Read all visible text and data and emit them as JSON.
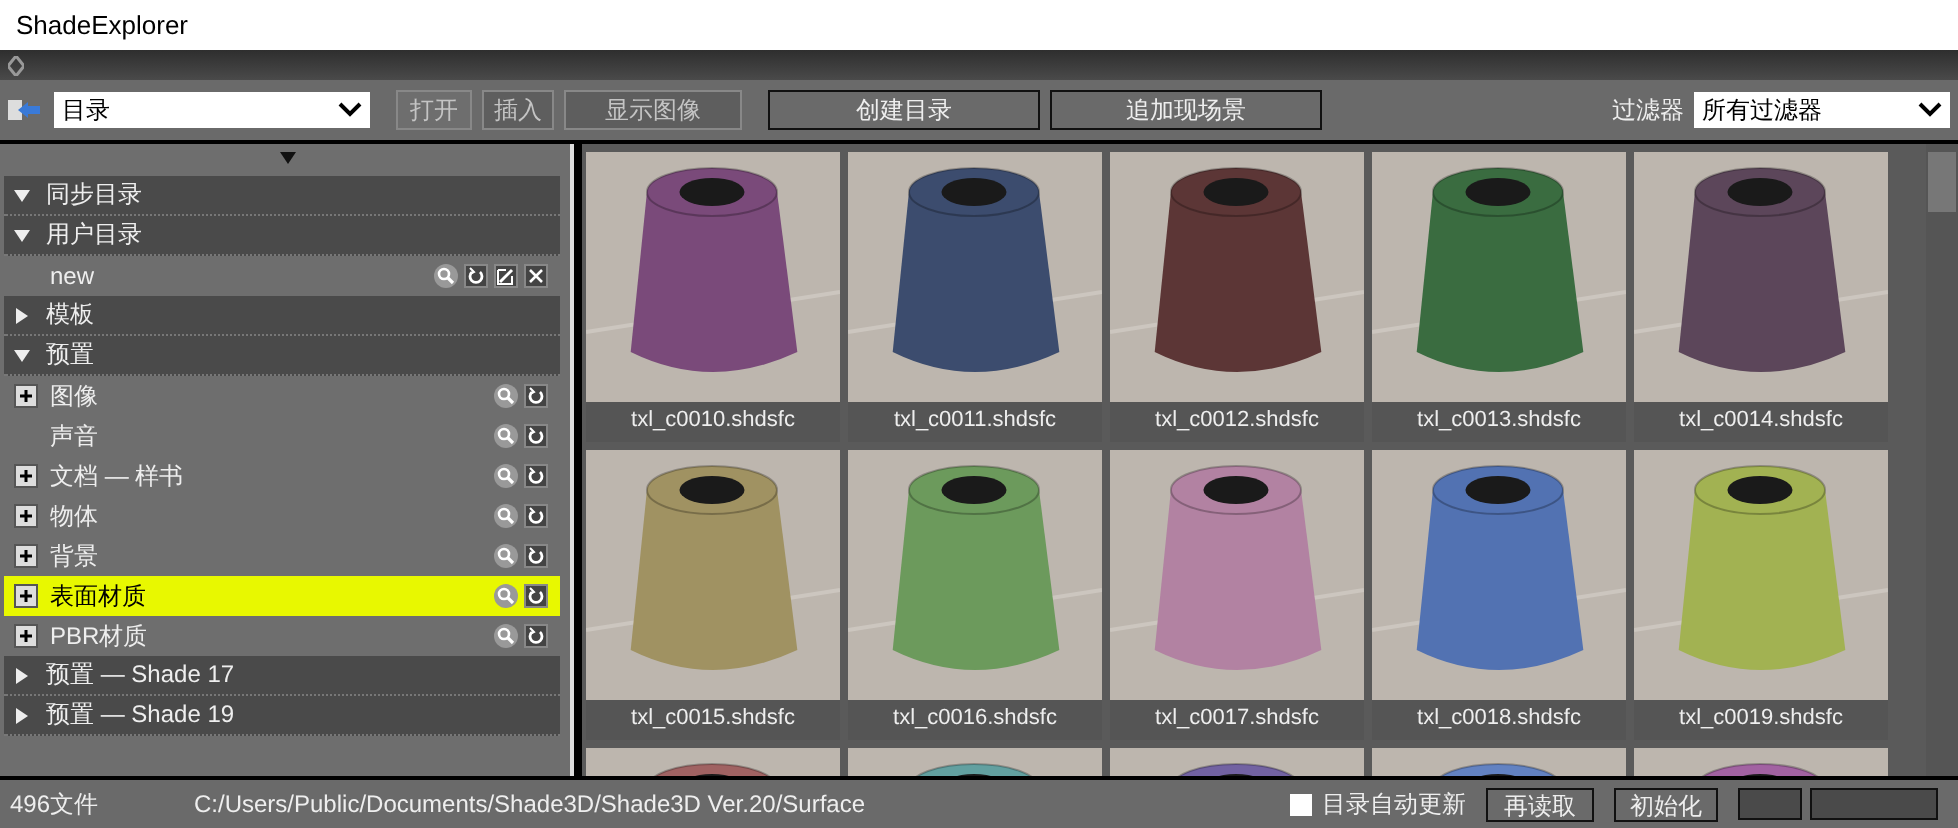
{
  "window": {
    "title": "ShadeExplorer"
  },
  "toolbar": {
    "catalog_select": "目录",
    "buttons": [
      {
        "label": "打开",
        "disabled": true
      },
      {
        "label": "插入",
        "disabled": true
      },
      {
        "label": "显示图像",
        "disabled": true
      }
    ],
    "actions": [
      "创建目录",
      "追加现场景"
    ],
    "filter_label": "过滤器",
    "filter_select": "所有过滤器"
  },
  "tree": [
    {
      "kind": "section",
      "label": "同步目录",
      "expanded": true
    },
    {
      "kind": "section",
      "label": "用户目录",
      "expanded": true
    },
    {
      "kind": "item",
      "label": "new",
      "expandable": false,
      "editable": true,
      "selected": false
    },
    {
      "kind": "section",
      "label": "模板",
      "expanded": false
    },
    {
      "kind": "section",
      "label": "预置",
      "expanded": true
    },
    {
      "kind": "item",
      "label": "图像",
      "expandable": true,
      "editable": false,
      "selected": false
    },
    {
      "kind": "item",
      "label": "声音",
      "expandable": false,
      "editable": false,
      "selected": false
    },
    {
      "kind": "item",
      "label": "文档 — 样书",
      "expandable": true,
      "editable": false,
      "selected": false
    },
    {
      "kind": "item",
      "label": "物体",
      "expandable": true,
      "editable": false,
      "selected": false
    },
    {
      "kind": "item",
      "label": "背景",
      "expandable": true,
      "editable": false,
      "selected": false
    },
    {
      "kind": "item",
      "label": "表面材质",
      "expandable": true,
      "editable": false,
      "selected": true
    },
    {
      "kind": "item",
      "label": "PBR材质",
      "expandable": true,
      "editable": false,
      "selected": false
    },
    {
      "kind": "section",
      "label": "预置 — Shade 17",
      "expanded": false
    },
    {
      "kind": "section",
      "label": "预置 — Shade 19",
      "expanded": false
    }
  ],
  "thumbnails": [
    {
      "name": "txl_c0010.shdsfc",
      "color": "#7a4a7a"
    },
    {
      "name": "txl_c0011.shdsfc",
      "color": "#3c4c6e"
    },
    {
      "name": "txl_c0012.shdsfc",
      "color": "#5c3636"
    },
    {
      "name": "txl_c0013.shdsfc",
      "color": "#3a6c40"
    },
    {
      "name": "txl_c0014.shdsfc",
      "color": "#5c465a"
    },
    {
      "name": "txl_c0015.shdsfc",
      "color": "#a09262"
    },
    {
      "name": "txl_c0016.shdsfc",
      "color": "#6c9a5c"
    },
    {
      "name": "txl_c0017.shdsfc",
      "color": "#b282a2"
    },
    {
      "name": "txl_c0018.shdsfc",
      "color": "#5272b2"
    },
    {
      "name": "txl_c0019.shdsfc",
      "color": "#a2b252"
    },
    {
      "color": "#a06262"
    },
    {
      "color": "#62a0a0"
    },
    {
      "color": "#7262a2"
    },
    {
      "color": "#6282c2"
    },
    {
      "color": "#a262a2"
    }
  ],
  "status_bar": {
    "count": "496文件",
    "path": "C:/Users/Public/Documents/Shade3D/Shade3D Ver.20/Surface",
    "auto_update": {
      "label": "目录自动更新",
      "checked": false
    },
    "buttons": [
      "再读取",
      "初始化"
    ]
  }
}
